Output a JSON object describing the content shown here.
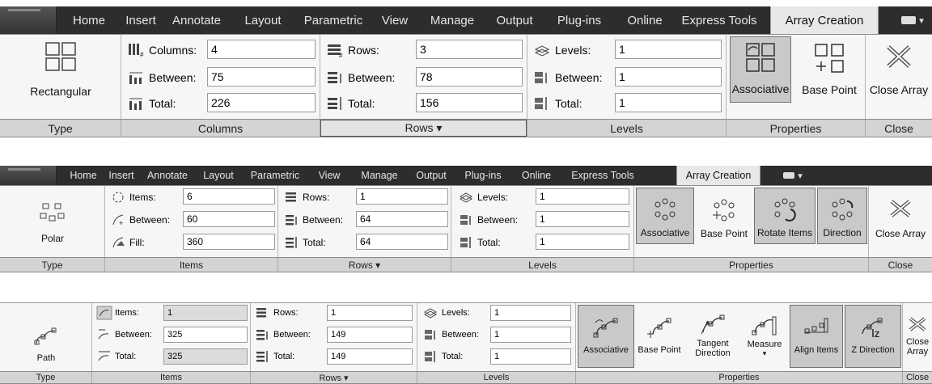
{
  "tabs": [
    "Home",
    "Insert",
    "Annotate",
    "Layout",
    "Parametric",
    "View",
    "Manage",
    "Output",
    "Plug-ins",
    "Online",
    "Express Tools",
    "Array Creation"
  ],
  "tab_extra": "▾",
  "ribbon1": {
    "type_button": "Rectangular",
    "columns": {
      "label": "Columns:",
      "value": "4"
    },
    "col_between": {
      "label": "Between:",
      "value": "75"
    },
    "col_total": {
      "label": "Total:",
      "value": "226"
    },
    "rows": {
      "label": "Rows:",
      "value": "3"
    },
    "row_between": {
      "label": "Between:",
      "value": "78"
    },
    "row_total": {
      "label": "Total:",
      "value": "156"
    },
    "levels": {
      "label": "Levels:",
      "value": "1"
    },
    "lvl_between": {
      "label": "Between:",
      "value": "1"
    },
    "lvl_total": {
      "label": "Total:",
      "value": "1"
    },
    "associative": "Associative",
    "base_point": "Base Point",
    "close_array": "Close Array",
    "titles": {
      "type": "Type",
      "columns": "Columns",
      "rows": "Rows ▾",
      "levels": "Levels",
      "properties": "Properties",
      "close": "Close"
    }
  },
  "ribbon2": {
    "type_button": "Polar",
    "items": {
      "label": "Items:",
      "value": "6"
    },
    "item_between": {
      "label": "Between:",
      "value": "60"
    },
    "fill": {
      "label": "Fill:",
      "value": "360"
    },
    "rows": {
      "label": "Rows:",
      "value": "1"
    },
    "row_between": {
      "label": "Between:",
      "value": "64"
    },
    "row_total": {
      "label": "Total:",
      "value": "64"
    },
    "levels": {
      "label": "Levels:",
      "value": "1"
    },
    "lvl_between": {
      "label": "Between:",
      "value": "1"
    },
    "lvl_total": {
      "label": "Total:",
      "value": "1"
    },
    "associative": "Associative",
    "base_point": "Base Point",
    "rotate_items": "Rotate Items",
    "direction": "Direction",
    "close_array": "Close Array",
    "titles": {
      "type": "Type",
      "items": "Items",
      "rows": "Rows ▾",
      "levels": "Levels",
      "properties": "Properties",
      "close": "Close"
    }
  },
  "ribbon3": {
    "type_button": "Path",
    "items": {
      "label": "Items:",
      "value": "1"
    },
    "item_between": {
      "label": "Between:",
      "value": "325"
    },
    "item_total": {
      "label": "Total:",
      "value": "325"
    },
    "rows": {
      "label": "Rows:",
      "value": "1"
    },
    "row_between": {
      "label": "Between:",
      "value": "149"
    },
    "row_total": {
      "label": "Total:",
      "value": "149"
    },
    "levels": {
      "label": "Levels:",
      "value": "1"
    },
    "lvl_between": {
      "label": "Between:",
      "value": "1"
    },
    "lvl_total": {
      "label": "Total:",
      "value": "1"
    },
    "associative": "Associative",
    "base_point": "Base Point",
    "tangent_direction_1": "Tangent",
    "tangent_direction_2": "Direction",
    "measure": "Measure",
    "measure_arrow": "▾",
    "align_items": "Align Items",
    "z_direction": "Z Direction",
    "close_1": "Close",
    "close_2": "Array",
    "titles": {
      "type": "Type",
      "items": "Items",
      "rows": "Rows ▾",
      "levels": "Levels",
      "properties": "Properties",
      "close": "Close"
    }
  }
}
